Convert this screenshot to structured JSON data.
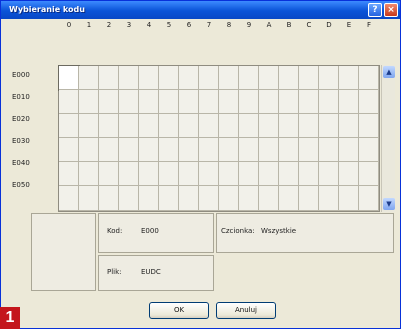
{
  "window": {
    "title": "Wybieranie kodu",
    "help_glyph": "?",
    "close_glyph": "×"
  },
  "grid": {
    "column_headers": [
      "0",
      "1",
      "2",
      "3",
      "4",
      "5",
      "6",
      "7",
      "8",
      "9",
      "A",
      "B",
      "C",
      "D",
      "E",
      "F"
    ],
    "row_headers": [
      "E000",
      "E010",
      "E020",
      "E030",
      "E040",
      "E050"
    ],
    "selected_cell": [
      0,
      0
    ]
  },
  "scrollbar": {
    "up_glyph": "▲",
    "down_glyph": "▼"
  },
  "info": {
    "code_label": "Kod:",
    "code_value": "E000",
    "font_label": "Czcionka:",
    "font_value": "Wszystkie",
    "file_label": "Plik:",
    "file_value": "EUDC"
  },
  "buttons": {
    "ok_label": "OK",
    "cancel_label": "Anuluj"
  },
  "badge": {
    "number": "1"
  },
  "colors": {
    "titlebar": "#0a53d7",
    "badge": "#c4161c",
    "dialog_bg": "#ece9d8"
  }
}
